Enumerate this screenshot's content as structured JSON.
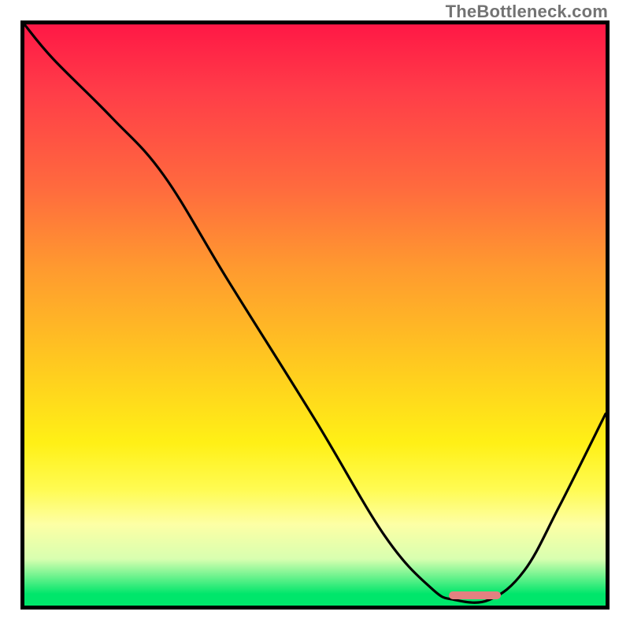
{
  "watermark": "TheBottleneck.com",
  "chart_data": {
    "type": "line",
    "title": "",
    "xlabel": "",
    "ylabel": "",
    "xlim": [
      0,
      100
    ],
    "ylim": [
      0,
      100
    ],
    "grid": false,
    "legend": false,
    "series": [
      {
        "name": "bottleneck-curve",
        "x": [
          0,
          5,
          15,
          24,
          35,
          50,
          62,
          70,
          74,
          80,
          86,
          92,
          100
        ],
        "y": [
          100,
          94,
          84,
          74,
          56,
          32,
          12,
          3,
          1,
          1,
          6,
          17,
          33
        ]
      }
    ],
    "marker": {
      "name": "optimal-range",
      "x_start": 73,
      "x_end": 82,
      "color": "#e38181"
    },
    "background_gradient": {
      "top": "#ff1846",
      "bottom": "#00e66b"
    }
  }
}
